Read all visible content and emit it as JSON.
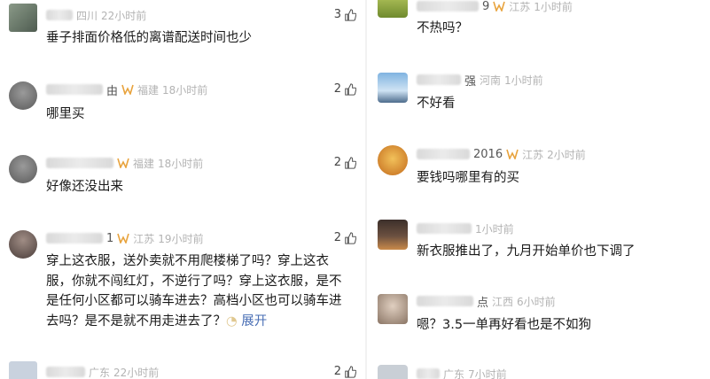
{
  "left": [
    {
      "region": "四川",
      "time": "22小时前",
      "text": "垂子排面价格低的离谱配送时间也少",
      "likes": "3",
      "name_suffix": ""
    },
    {
      "region": "福建",
      "time": "18小时前",
      "text": "哪里买",
      "likes": "2",
      "name_suffix": "由"
    },
    {
      "region": "福建",
      "time": "18小时前",
      "text": "好像还没出来",
      "likes": "2",
      "name_suffix": ""
    },
    {
      "region": "江苏",
      "time": "19小时前",
      "text": "穿上这衣服，送外卖就不用爬楼梯了吗？穿上这衣服，你就不闯红灯，不逆行了吗？穿上这衣服，是不是任何小区都可以骑车进去？高档小区也可以骑车进去吗？是不是就不用走进去了？",
      "more": "展开",
      "likes": "2",
      "name_suffix": "1"
    },
    {
      "region": "广东",
      "time": "22小时前",
      "text": "",
      "likes": "2",
      "name_suffix": ""
    }
  ],
  "right": [
    {
      "region": "江苏",
      "time": "1小时前",
      "text": "不热吗？",
      "name_suffix": "9"
    },
    {
      "region": "河南",
      "time": "1小时前",
      "text": "不好看",
      "name_suffix": "强"
    },
    {
      "region": "江苏",
      "time": "2小时前",
      "text": "要钱吗哪里有的买",
      "name_suffix": "2016"
    },
    {
      "region": "",
      "time": "1小时前",
      "text": "新衣服推出了，九月开始单价也下调了",
      "name_suffix": ""
    },
    {
      "region": "江西",
      "time": "6小时前",
      "text": "嗯？3.5一单再好看也是不如狗",
      "name_suffix": "点"
    },
    {
      "region": "广东",
      "time": "7小时前",
      "text": "",
      "name_suffix": ""
    }
  ],
  "icons": {
    "like": "thumb-up-icon",
    "vip": "vip-badge-icon"
  },
  "colors": {
    "meta": "#b3b3b3",
    "link": "#4a6fb5",
    "vip": "#e8a33d"
  }
}
